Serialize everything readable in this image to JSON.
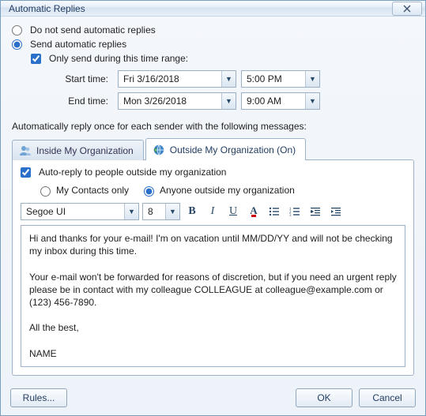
{
  "window": {
    "title": "Automatic Replies"
  },
  "mode": {
    "do_not_send": "Do not send automatic replies",
    "send": "Send automatic replies",
    "selected": "send"
  },
  "time_range": {
    "checkbox_label": "Only send during this time range:",
    "checked": true,
    "start_label": "Start time:",
    "start_date": "Fri 3/16/2018",
    "start_time": "5:00 PM",
    "end_label": "End time:",
    "end_date": "Mon 3/26/2018",
    "end_time": "9:00 AM"
  },
  "section_label": "Automatically reply once for each sender with the following messages:",
  "tabs": {
    "inside": "Inside My Organization",
    "outside": "Outside My Organization (On)",
    "active": "outside"
  },
  "outside_panel": {
    "auto_reply_checkbox": "Auto-reply to people outside my organization",
    "auto_reply_checked": true,
    "scope": {
      "contacts_only": "My Contacts only",
      "anyone": "Anyone outside my organization",
      "selected": "anyone"
    },
    "toolbar": {
      "font": "Segoe UI",
      "size": "8"
    },
    "body": "Hi and thanks for your e-mail! I'm on vacation until MM/DD/YY and will not be checking my inbox during this time.\n\nYour e-mail won't be forwarded for reasons of discretion, but if you need an urgent reply please be in contact with my colleague COLLEAGUE at colleague@example.com or (123) 456-7890.\n\nAll the best,\n\nNAME"
  },
  "footer": {
    "rules": "Rules...",
    "ok": "OK",
    "cancel": "Cancel"
  }
}
